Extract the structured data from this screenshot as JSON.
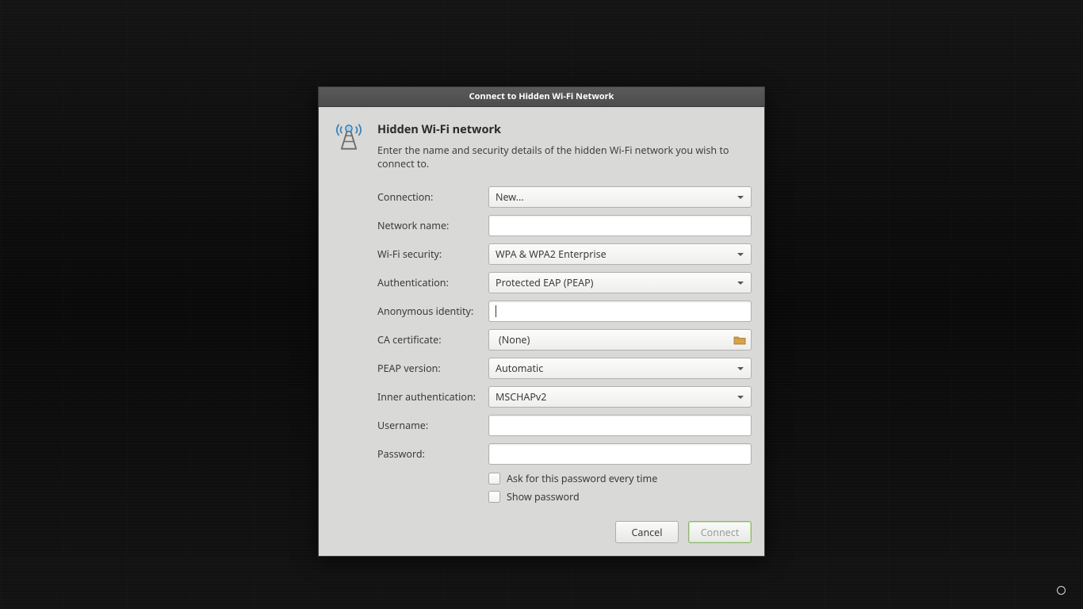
{
  "window": {
    "title": "Connect to Hidden Wi-Fi Network"
  },
  "header": {
    "heading": "Hidden Wi-Fi network",
    "description": "Enter the name and security details of the hidden Wi-Fi network you wish to connect to."
  },
  "labels": {
    "connection": "Connection:",
    "network_name": "Network name:",
    "wifi_security": "Wi-Fi security:",
    "authentication": "Authentication:",
    "anonymous_identity": "Anonymous identity:",
    "ca_certificate": "CA certificate:",
    "peap_version": "PEAP version:",
    "inner_authentication": "Inner authentication:",
    "username": "Username:",
    "password": "Password:"
  },
  "values": {
    "connection": "New...",
    "network_name": "",
    "wifi_security": "WPA & WPA2 Enterprise",
    "authentication": "Protected EAP (PEAP)",
    "anonymous_identity": "",
    "ca_certificate": "(None)",
    "peap_version": "Automatic",
    "inner_authentication": "MSCHAPv2",
    "username": "",
    "password": ""
  },
  "checkboxes": {
    "ask_password": "Ask for this password every time",
    "show_password": "Show password"
  },
  "buttons": {
    "cancel": "Cancel",
    "connect": "Connect"
  }
}
